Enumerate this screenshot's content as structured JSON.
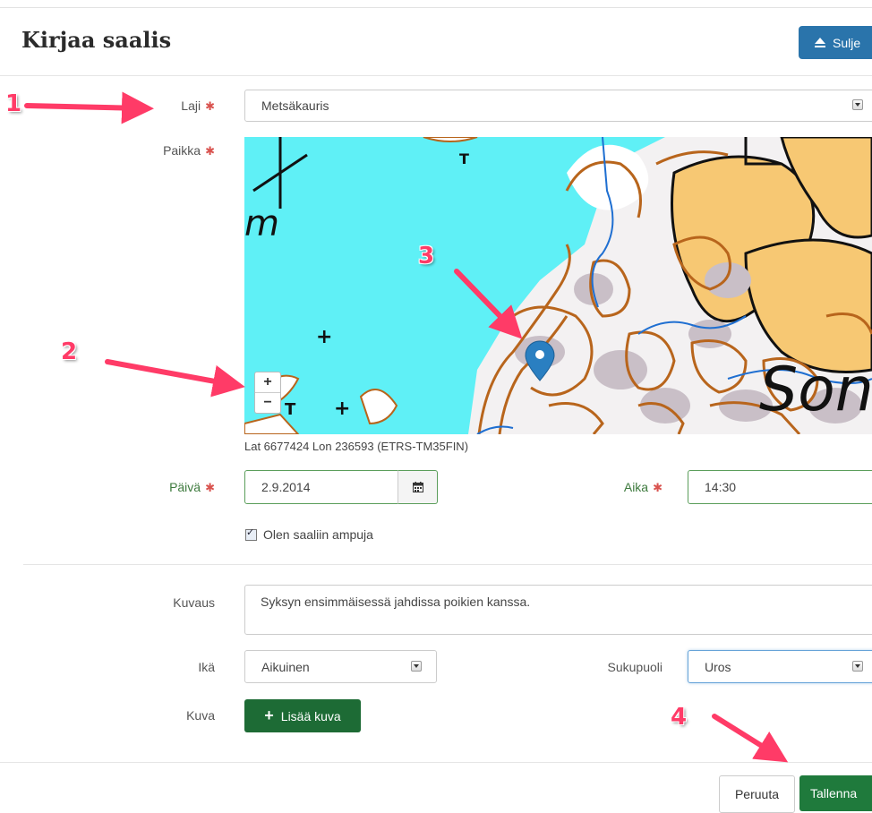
{
  "modal": {
    "title": "Kirjaa saalis",
    "close_label": "Sulje"
  },
  "fields": {
    "species": {
      "label": "Laji",
      "value": "Metsäkauris"
    },
    "place": {
      "label": "Paikka",
      "coords": "Lat 6677424 Lon 236593 (ETRS-TM35FIN)",
      "map_text": "Son",
      "map_text_2": "m",
      "zoom_in": "+",
      "zoom_out": "−"
    },
    "date": {
      "label": "Päivä",
      "value": "2.9.2014"
    },
    "time": {
      "label": "Aika",
      "value": "14:30"
    },
    "shooter": {
      "label": "Olen saaliin ampuja",
      "checked": true
    },
    "description": {
      "label": "Kuvaus",
      "value": "Syksyn ensimmäisessä jahdissa poikien kanssa."
    },
    "age": {
      "label": "Ikä",
      "value": "Aikuinen"
    },
    "gender": {
      "label": "Sukupuoli",
      "value": "Uros"
    },
    "image": {
      "label": "Kuva",
      "button": "Lisää kuva"
    }
  },
  "required_marker": "✱",
  "footer": {
    "cancel": "Peruuta",
    "save": "Tallenna"
  },
  "annotations": [
    "1",
    "2",
    "3",
    "4"
  ],
  "colors": {
    "primary": "#2a74ab",
    "success": "#1f7a3c",
    "annotation": "#ff3b67",
    "required": "#d9534f",
    "water": "#5ff0f6",
    "land": "#f7c873",
    "contour": "#b8651c"
  }
}
